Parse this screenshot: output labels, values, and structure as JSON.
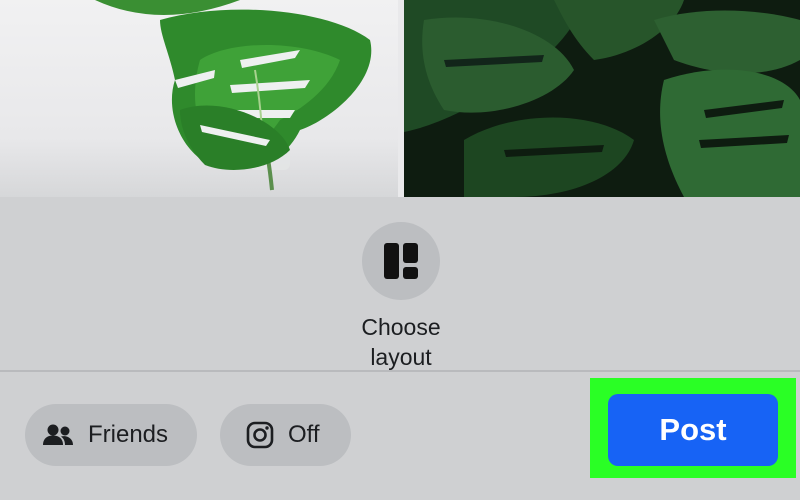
{
  "layout_option": {
    "icon": "layout-grid-icon",
    "label_line1": "Choose",
    "label_line2": "layout"
  },
  "audience": {
    "icon": "friends-icon",
    "label": "Friends"
  },
  "instagram": {
    "icon": "instagram-icon",
    "label": "Off"
  },
  "post_button": {
    "label": "Post"
  },
  "colors": {
    "post_blue": "#1763f5",
    "highlight_green": "#2aff25",
    "pill_gray": "#bcbec1",
    "background": "#cfd0d2"
  }
}
